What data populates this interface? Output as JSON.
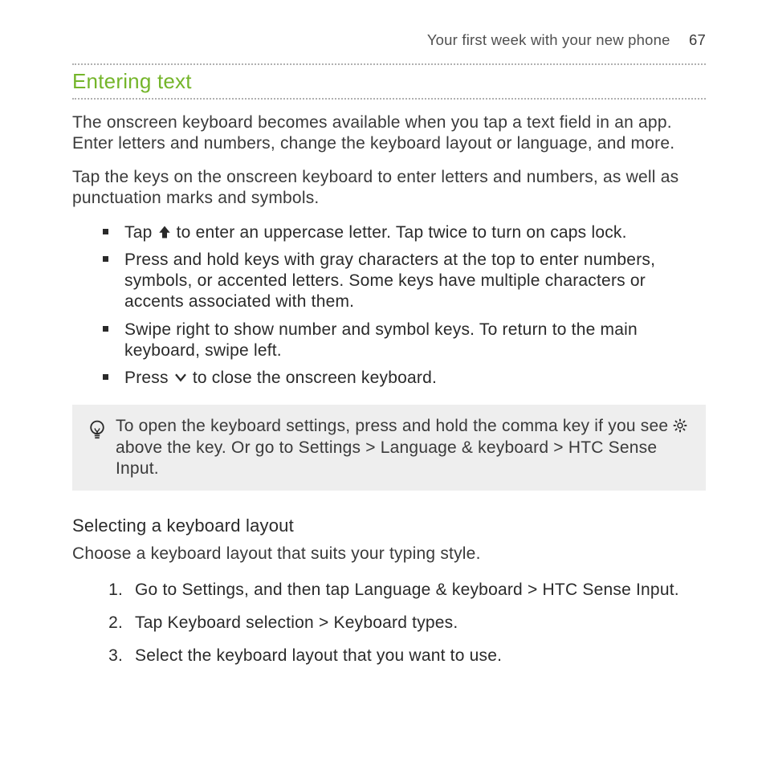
{
  "header": {
    "title": "Your first week with your new phone",
    "page": "67"
  },
  "section": {
    "title": "Entering text"
  },
  "paras": {
    "intro1": "The onscreen keyboard becomes available when you tap a text field in an app. Enter letters and numbers, change the keyboard layout or language, and more.",
    "intro2": "Tap the keys on the onscreen keyboard to enter letters and numbers, as well as punctuation marks and symbols."
  },
  "bullets": {
    "b1a": "Tap ",
    "b1b": " to enter an uppercase letter. Tap twice to turn on caps lock.",
    "b2": "Press and hold keys with gray characters at the top to enter numbers, symbols, or accented letters. Some keys have multiple characters or accents associated with them.",
    "b3": "Swipe right to show number and symbol keys. To return to the main keyboard, swipe left.",
    "b4a": "Press ",
    "b4b": " to close the onscreen keyboard."
  },
  "tip": {
    "a": "To open the keyboard settings, press and hold the comma key if you see ",
    "b": " above the key. Or go to ",
    "settings": "Settings",
    "gt1": " > ",
    "lang": "Language & keyboard",
    "gt2": " > ",
    "sense": "HTC Sense Input",
    "dot": "."
  },
  "sub": {
    "title": "Selecting a keyboard layout"
  },
  "paras2": {
    "choose": "Choose a keyboard layout that suits your typing style."
  },
  "steps": {
    "s1a": "Go to Settings, and then tap ",
    "s1b": "Language & keyboard",
    "s1c": " > ",
    "s1d": "HTC Sense Input",
    "s1e": ".",
    "s2a": "Tap ",
    "s2b": "Keyboard selection",
    "s2c": " > ",
    "s2d": "Keyboard types",
    "s2e": ".",
    "s3": "Select the keyboard layout that you want to use."
  }
}
